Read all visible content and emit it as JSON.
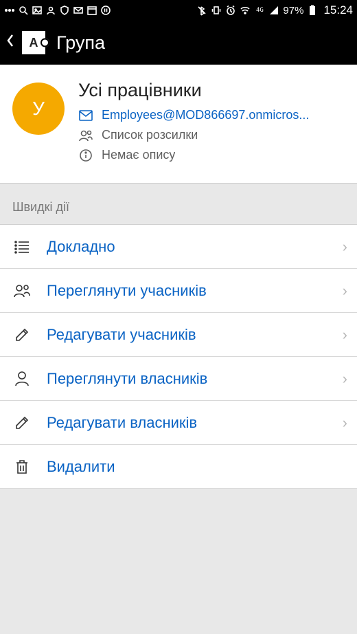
{
  "status": {
    "battery_pct": "97%",
    "time": "15:24"
  },
  "header": {
    "title": "Група"
  },
  "group": {
    "avatar_letter": "У",
    "name": "Усі працівники",
    "email": "Employees@MOD866697.onmicros...",
    "type": "Список розсилки",
    "description": "Немає опису"
  },
  "section": {
    "quick_actions": "Швидкі дії"
  },
  "actions": {
    "details": "Докладно",
    "view_members": "Переглянути учасників",
    "edit_members": "Редагувати учасників",
    "view_owners": "Переглянути власників",
    "edit_owners": "Редагувати власників",
    "delete": "Видалити"
  }
}
